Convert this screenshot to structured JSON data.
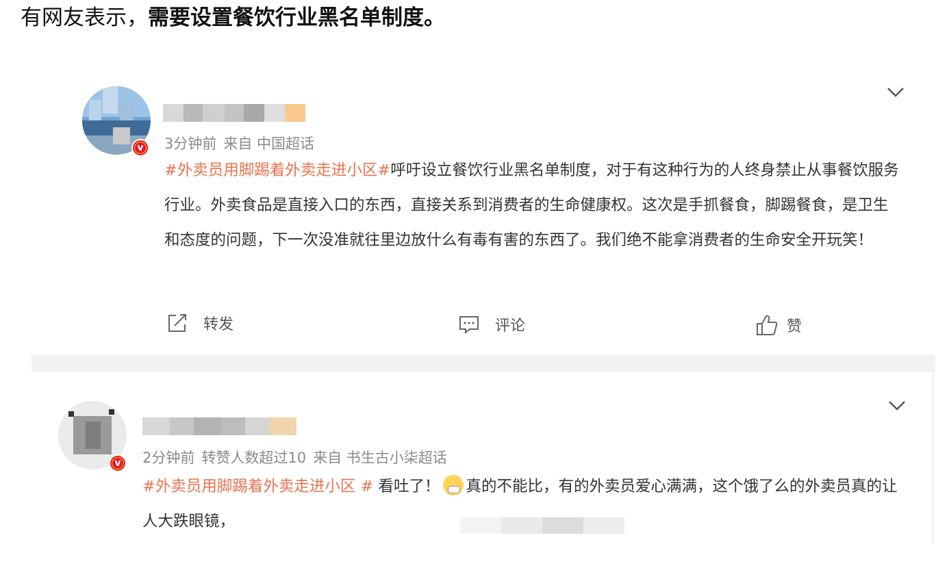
{
  "headline": {
    "prefix": "有网友表示，",
    "bold": "需要设置餐饮行业黑名单制度。"
  },
  "posts": [
    {
      "meta": {
        "time": "3分钟前",
        "source": "来自 中国超话"
      },
      "badge": "v",
      "hashtag": "#外卖员用脚踢着外卖走进小区#",
      "text": "呼吁设立餐饮行业黑名单制度，对于有这种行为的人终身禁止从事餐饮服务行业。外卖食品是直接入口的东西，直接关系到消费者的生命健康权。这次是手抓餐食，脚踢餐食，是卫生和态度的问题，下一次没准就往里边放什么有毒有害的东西了。我们绝不能拿消费者的生命安全开玩笑！",
      "actions": {
        "repost": "转发",
        "comment": "评论",
        "like": "赞"
      }
    },
    {
      "meta": {
        "time": "2分钟前",
        "extra": "转赞人数超过10",
        "source": "来自 书生古小柒超话"
      },
      "badge": "v",
      "hashtag": "#外卖员用脚踢着外卖走进小区 #",
      "text_before_emoji": " 看吐了！",
      "text_after_emoji": "真的不能比，有的外卖员爱心满满，这个饿了么的外卖员真的让人大跌眼镜，"
    }
  ],
  "icons": {
    "chevron": "chevron-down-icon",
    "repost": "repost-icon",
    "comment": "comment-icon",
    "like": "thumbs-up-icon",
    "emoji": "vomit-emoji-icon"
  },
  "colors": {
    "hashtag": "#eb7350",
    "badge": "#e6162d",
    "meta": "#8a8a8a"
  }
}
